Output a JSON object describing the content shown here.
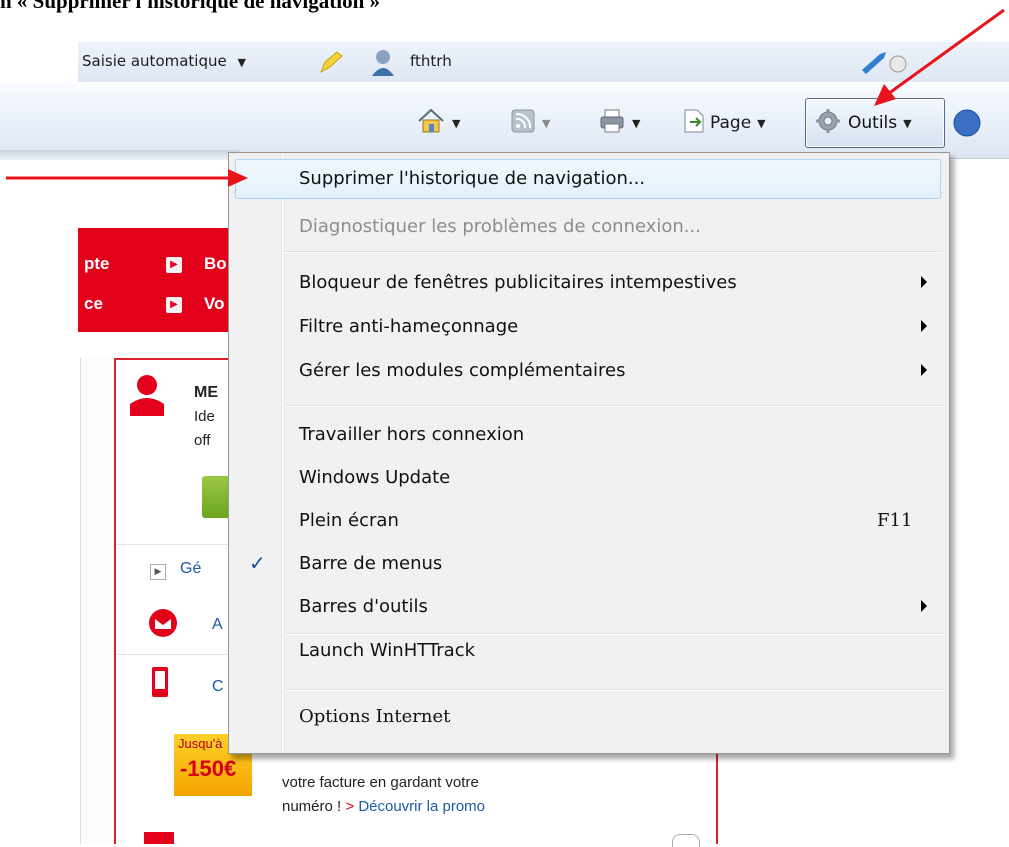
{
  "doc": {
    "heading": "n « Supprimer l'historique de navigation »"
  },
  "favbar": {
    "autocomplete": "Saisie automatique",
    "username": "fthtrh"
  },
  "cmdbar": {
    "page_label": "Page",
    "tools_label": "Outils"
  },
  "bg_page": {
    "nav_links": [
      "pte",
      "ce",
      "Bo",
      "Vo"
    ],
    "account_title": "ME",
    "account_line1": "Ide",
    "account_line2": "off",
    "row1": "Gé",
    "row2": "A",
    "row3": "C",
    "promo_badge_top": "Jusqu'à",
    "promo_badge_amount": "-150€",
    "promo_line1": "votre facture en gardant votre",
    "promo_line2": "numéro !",
    "promo_link": "Découvrir la promo",
    "promo_link_marker": ">"
  },
  "menu": {
    "items": [
      {
        "label": "Supprimer l'historique de navigation...",
        "state": "highlighted"
      },
      {
        "label": "Diagnostiquer les problèmes de connexion...",
        "state": "disabled"
      },
      {
        "label": "Bloqueur de fenêtres publicitaires intempestives",
        "submenu": true
      },
      {
        "label": "Filtre anti-hameçonnage",
        "submenu": true
      },
      {
        "label": "Gérer les modules complémentaires",
        "submenu": true
      },
      {
        "label": "Travailler hors connexion"
      },
      {
        "label": "Windows Update"
      },
      {
        "label": "Plein écran",
        "shortcut": "F11"
      },
      {
        "label": "Barre de menus",
        "checked": true
      },
      {
        "label": "Barres d'outils",
        "submenu": true
      },
      {
        "label": "Launch WinHTTrack"
      },
      {
        "label": "Options Internet"
      }
    ],
    "check_glyph": "✓"
  },
  "colors": {
    "annotation_arrow": "#e8131b",
    "brand_red": "#e2001a",
    "menu_highlight": "#e1f1fb"
  }
}
